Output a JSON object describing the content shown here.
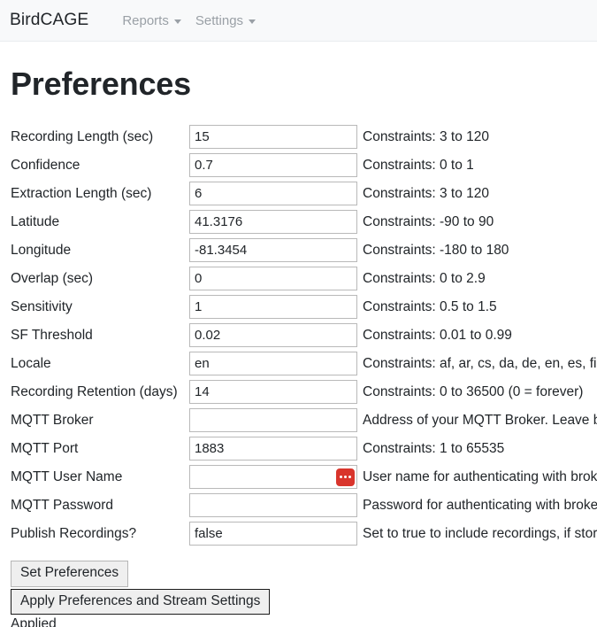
{
  "navbar": {
    "brand": "BirdCAGE",
    "items": [
      {
        "label": "Reports",
        "icon": "caret-down-icon"
      },
      {
        "label": "Settings",
        "icon": "caret-down-icon"
      }
    ]
  },
  "page": {
    "title": "Preferences"
  },
  "form": {
    "rows": [
      {
        "label": "Recording Length (sec)",
        "value": "15",
        "placeholder": "",
        "help": "Constraints: 3 to 120",
        "badge": false
      },
      {
        "label": "Confidence",
        "value": "0.7",
        "placeholder": "",
        "help": "Constraints: 0 to 1",
        "badge": false
      },
      {
        "label": "Extraction Length (sec)",
        "value": "6",
        "placeholder": "",
        "help": "Constraints: 3 to 120",
        "badge": false
      },
      {
        "label": "Latitude",
        "value": "41.3176",
        "placeholder": "",
        "help": "Constraints: -90 to 90",
        "badge": false
      },
      {
        "label": "Longitude",
        "value": "-81.3454",
        "placeholder": "",
        "help": "Constraints: -180 to 180",
        "badge": false
      },
      {
        "label": "Overlap (sec)",
        "value": "0",
        "placeholder": "",
        "help": "Constraints: 0 to 2.9",
        "badge": false
      },
      {
        "label": "Sensitivity",
        "value": "1",
        "placeholder": "",
        "help": "Constraints: 0.5 to 1.5",
        "badge": false
      },
      {
        "label": "SF Threshold",
        "value": "0.02",
        "placeholder": "",
        "help": "Constraints: 0.01 to 0.99",
        "badge": false
      },
      {
        "label": "Locale",
        "value": "en",
        "placeholder": "",
        "help": "Constraints: af, ar, cs, da, de, en, es, fi, fr, hu",
        "badge": false
      },
      {
        "label": "Recording Retention (days)",
        "value": "14",
        "placeholder": "",
        "help": "Constraints: 0 to 36500 (0 = forever)",
        "badge": false
      },
      {
        "label": "MQTT Broker",
        "value": "",
        "placeholder": "",
        "help": "Address of your MQTT Broker. Leave blank to disable",
        "badge": false
      },
      {
        "label": "MQTT Port",
        "value": "1883",
        "placeholder": "",
        "help": "Constraints: 1 to 65535",
        "badge": false
      },
      {
        "label": "MQTT User Name",
        "value": "",
        "placeholder": "",
        "help": "User name for authenticating with broker",
        "badge": true
      },
      {
        "label": "MQTT Password",
        "value": "",
        "placeholder": "",
        "help": "Password for authenticating with broker",
        "badge": false
      },
      {
        "label": "Publish Recordings?",
        "value": "false",
        "placeholder": "",
        "help": "Set to true to include recordings, if stored",
        "badge": false
      }
    ]
  },
  "actions": {
    "set_preferences": "Set Preferences",
    "apply_preferences": "Apply Preferences and Stream Settings",
    "status": "Applied"
  },
  "colors": {
    "navbar_bg": "#f8f9fa",
    "text": "#212529",
    "muted": "#9aa0a6",
    "input_border": "#b9b9b9",
    "badge_red": "#d9352c",
    "button_bg": "#efefef",
    "button_border": "#b6b6b6",
    "focus_border": "#1b1b1b"
  }
}
